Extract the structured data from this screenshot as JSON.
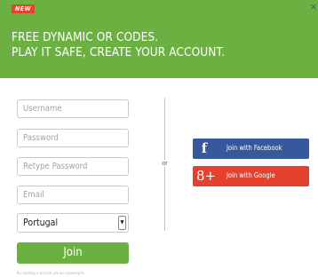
{
  "banner": {
    "badge": "NEW",
    "line1": "FREE DYNAMIC OR CODES.",
    "line2": "PLAY IT SAFE, CREATE YOUR ACCOUNT.",
    "close": "×",
    "color": "#6db042"
  },
  "form": {
    "username_placeholder": "Username",
    "password_placeholder": "Password",
    "retype_placeholder": "Retype Password",
    "email_placeholder": "Email",
    "country": "Portugal",
    "join_label": "Join",
    "disclaimer": "By creating a account you are agreeing to"
  },
  "divider": {
    "or_label": "or"
  },
  "social": {
    "facebook_label": "Join with Facebook",
    "facebook_glyph": "f",
    "google_label": "Join with Google",
    "google_glyph": "8+",
    "facebook_color": "#37589b",
    "google_color": "#e5412f"
  }
}
